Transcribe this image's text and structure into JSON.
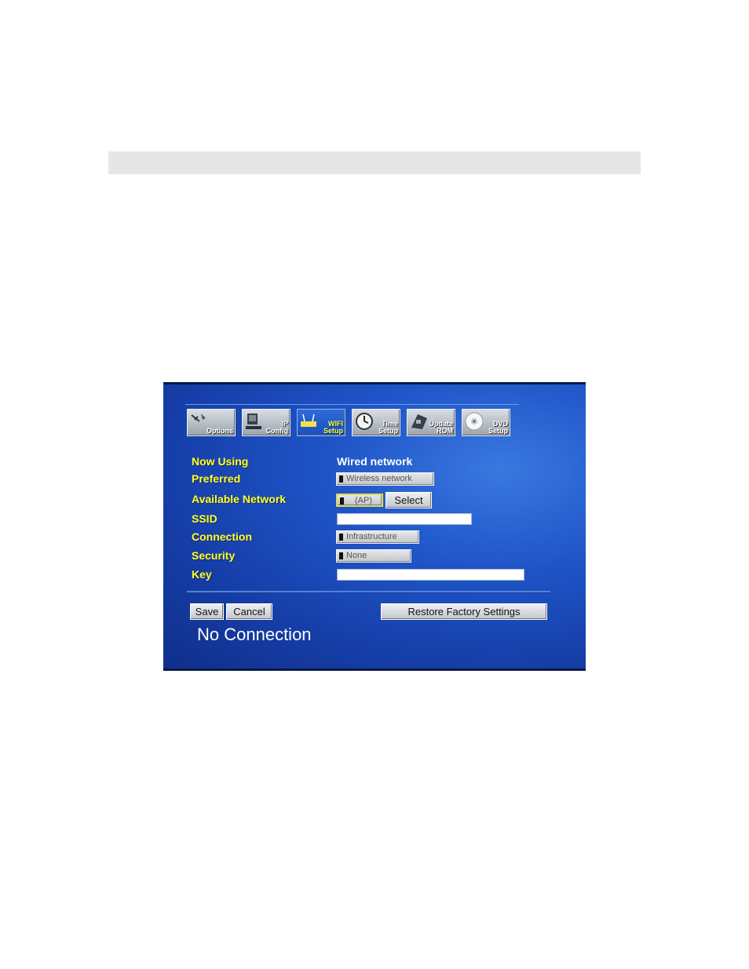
{
  "tabs": [
    {
      "label": "Options",
      "icon": "options-icon"
    },
    {
      "label": "IP\nConfig",
      "icon": "computer-icon"
    },
    {
      "label": "WIFI\nSetup",
      "icon": "wifi-router-icon"
    },
    {
      "label": "Time\nSetup",
      "icon": "clock-icon"
    },
    {
      "label": "Update\nROM",
      "icon": "update-rom-icon"
    },
    {
      "label": "DVD\nSetup",
      "icon": "dvd-disc-icon"
    }
  ],
  "form": {
    "now_using_label": "Now Using",
    "now_using_value": "Wired network",
    "preferred_label": "Preferred",
    "preferred_value": "Wireless network",
    "available_label": "Available Network",
    "available_value": "(AP)",
    "select_label": "Select",
    "ssid_label": "SSID",
    "ssid_value": "",
    "connection_label": "Connection",
    "connection_value": "Infrastructure",
    "security_label": "Security",
    "security_value": "None",
    "key_label": "Key",
    "key_value": ""
  },
  "buttons": {
    "save": "Save",
    "cancel": "Cancel",
    "restore": "Restore Factory Settings"
  },
  "status": "No Connection",
  "colors": {
    "label": "#ffff2a",
    "background": "#1f55c8"
  }
}
